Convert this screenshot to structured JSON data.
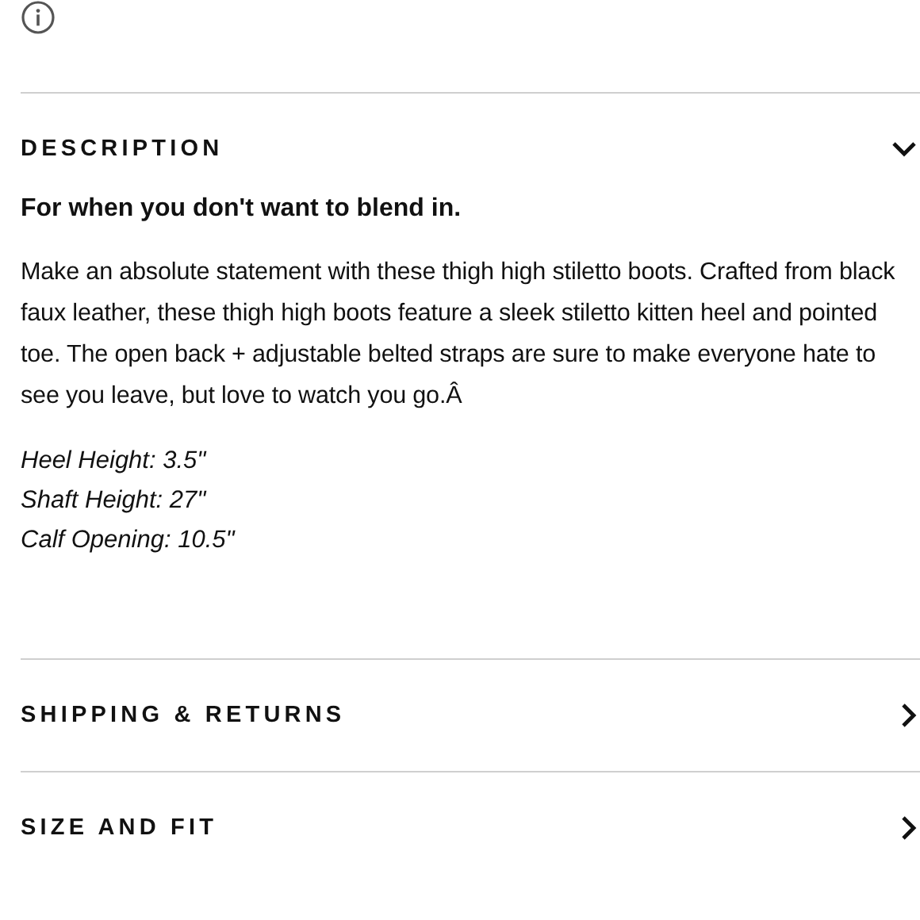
{
  "sections": [
    {
      "title": "DESCRIPTION",
      "expanded": true,
      "tagline": "For when you don't want to blend in.",
      "body": "Make an absolute statement with these thigh high stiletto boots. Crafted from black faux leather, these thigh high boots feature a sleek stiletto kitten heel and pointed toe. The open back + adjustable belted straps are sure to make everyone hate to see you leave, but love to watch you go.Â",
      "specs": [
        "Heel Height: 3.5\"",
        "Shaft Height: 27\"",
        "Calf Opening: 10.5\""
      ]
    },
    {
      "title": "SHIPPING & RETURNS",
      "expanded": false
    },
    {
      "title": "SIZE AND FIT",
      "expanded": false
    }
  ]
}
